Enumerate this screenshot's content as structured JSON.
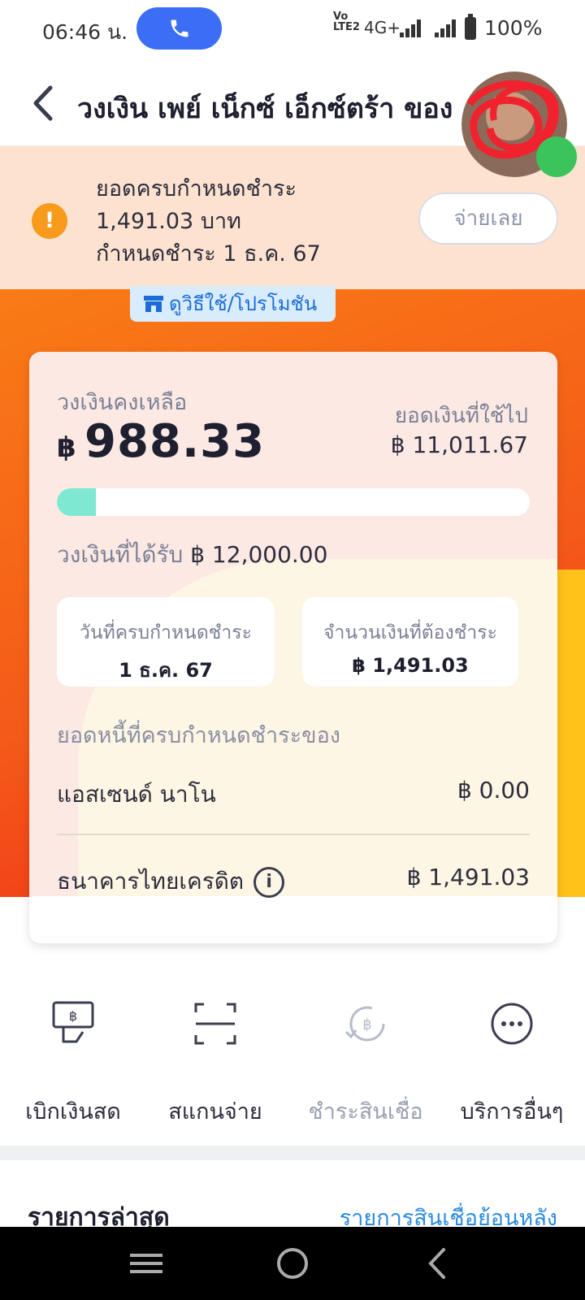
{
  "status_bar": {
    "time": "06:46 น.",
    "network_type": "VoLTE2",
    "data_label": "4G+",
    "battery": "100%"
  },
  "header": {
    "title": "วงเงิน เพย์ เน็กซ์ เอ็กซ์ตร้า ของ"
  },
  "due_banner": {
    "line1": "ยอดครบกำหนดชำระ",
    "line2": "1,491.03 บาท",
    "line3": "กำหนดชำระ 1 ธ.ค. 67",
    "pay_button": "จ่ายเลย"
  },
  "promo_chip": "ดูวิธีใช้/โปรโมชัน",
  "card": {
    "remaining_label": "วงเงินคงเหลือ",
    "currency": "฿",
    "remaining_value": "988.33",
    "used_label": "ยอดเงินที่ใช้ไป",
    "used_value": "฿ 11,011.67",
    "progress_fraction": 0.0824,
    "limit_label": "วงเงินที่ได้รับ",
    "limit_value": "฿ 12,000.00",
    "due_date_label": "วันที่ครบกำหนดชำระ",
    "due_date_value": "1 ธ.ค. 67",
    "amount_due_label": "จำนวนเงินที่ต้องชำระ",
    "amount_due_value": "฿ 1,491.03",
    "debt_section_label": "ยอดหนี้ที่ครบกำหนดชำระของ",
    "debts": [
      {
        "name": "แอสเซนด์ นาโน",
        "value": "฿ 0.00"
      },
      {
        "name": "ธนาคารไทยเครดิต",
        "value": "฿ 1,491.03"
      }
    ]
  },
  "actions": [
    {
      "label": "เบิกเงินสด",
      "icon": "cash-withdraw-icon",
      "enabled": true
    },
    {
      "label": "สแกนจ่าย",
      "icon": "scan-icon",
      "enabled": true
    },
    {
      "label": "ชำระสินเชื่อ",
      "icon": "repay-loan-icon",
      "enabled": false
    },
    {
      "label": "บริการอื่นๆ",
      "icon": "more-icon",
      "enabled": true
    }
  ],
  "recent": {
    "title": "รายการล่าสุด",
    "history_link": "รายการสินเชื่อย้อนหลัง"
  },
  "colors": {
    "accent_blue": "#3b6ef5",
    "warning_orange": "#f89a1c",
    "progress_fill": "#7ee8d2",
    "link_blue": "#2b8be0"
  }
}
